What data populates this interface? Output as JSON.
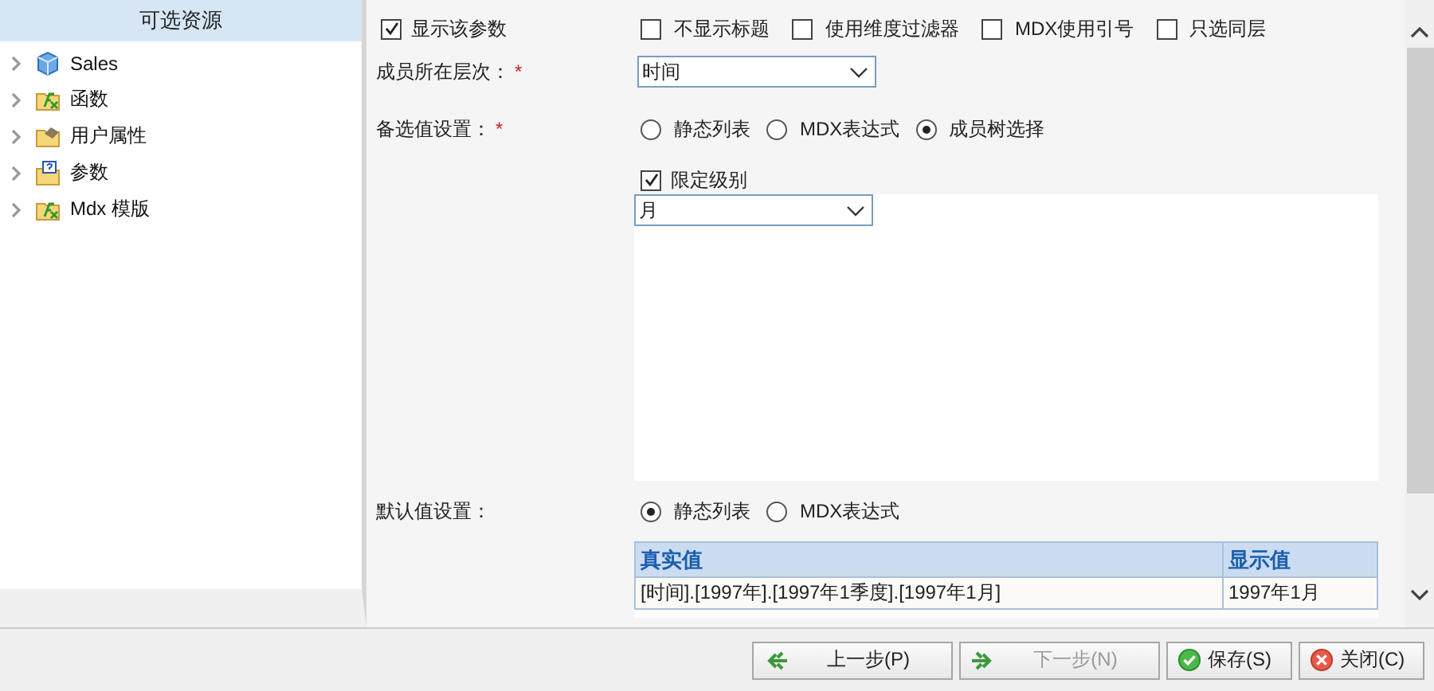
{
  "sidebar": {
    "title": "可选资源",
    "items": [
      {
        "label": "Sales",
        "kind": "cube",
        "expanded": false
      },
      {
        "label": "函数",
        "kind": "function",
        "expanded": false
      },
      {
        "label": "用户属性",
        "kind": "attribute",
        "expanded": false
      },
      {
        "label": "参数",
        "kind": "parameter",
        "expanded": false
      },
      {
        "label": "Mdx 模版",
        "kind": "function",
        "expanded": false
      }
    ]
  },
  "form": {
    "show_param": {
      "label": "显示该参数",
      "checked": true
    },
    "options": [
      {
        "label": "不显示标题",
        "checked": false
      },
      {
        "label": "使用维度过滤器",
        "checked": false
      },
      {
        "label": "MDX使用引号",
        "checked": false
      },
      {
        "label": "只选同层",
        "checked": false
      }
    ],
    "level": {
      "label": "成员所在层次：",
      "required_mark": "*",
      "value": "时间"
    },
    "candidates": {
      "label": "备选值设置：",
      "required_mark": "*",
      "radios": [
        {
          "label": "静态列表",
          "selected": false
        },
        {
          "label": "MDX表达式",
          "selected": false
        },
        {
          "label": "成员树选择",
          "selected": true
        }
      ],
      "limit_level": {
        "label": "限定级别",
        "checked": true
      },
      "level_value": "月"
    },
    "default": {
      "label": "默认值设置：",
      "radios": [
        {
          "label": "静态列表",
          "selected": true
        },
        {
          "label": "MDX表达式",
          "selected": false
        }
      ],
      "table": {
        "columns": [
          "真实值",
          "显示值"
        ],
        "rows": [
          [
            "[时间].[1997年].[1997年1季度].[1997年1月]",
            "1997年1月"
          ]
        ]
      }
    }
  },
  "buttons": [
    {
      "label": "上一步(P)",
      "kind": "prev",
      "disabled": false
    },
    {
      "label": "下一步(N)",
      "kind": "next",
      "disabled": true
    },
    {
      "label": "保存(S)",
      "kind": "save",
      "disabled": false
    },
    {
      "label": "关闭(C)",
      "kind": "close",
      "disabled": false
    }
  ]
}
